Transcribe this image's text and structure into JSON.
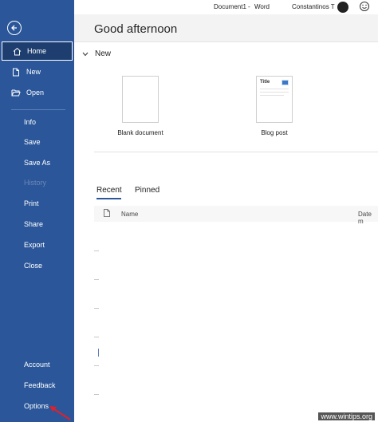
{
  "titlebar": {
    "document": "Document1",
    "separator": "-",
    "app": "Word",
    "user": "Constantinos T"
  },
  "sidebar": {
    "back_icon": "back-arrow-icon",
    "items": [
      {
        "label": "Home",
        "icon": "home-icon"
      },
      {
        "label": "New",
        "icon": "new-document-icon"
      },
      {
        "label": "Open",
        "icon": "folder-open-icon"
      },
      {
        "label": "Info"
      },
      {
        "label": "Save"
      },
      {
        "label": "Save As"
      },
      {
        "label": "History"
      },
      {
        "label": "Print"
      },
      {
        "label": "Share"
      },
      {
        "label": "Export"
      },
      {
        "label": "Close"
      },
      {
        "label": "Account"
      },
      {
        "label": "Feedback"
      },
      {
        "label": "Options"
      }
    ],
    "colors": {
      "background": "#2b579a",
      "selected": "#1e3e70"
    }
  },
  "main": {
    "greeting": "Good afternoon",
    "new_section": {
      "title": "New",
      "templates": [
        {
          "label": "Blank document"
        },
        {
          "label": "Blog post",
          "thumb_title": "Title"
        }
      ]
    },
    "tabs": [
      {
        "label": "Recent",
        "active": true
      },
      {
        "label": "Pinned",
        "active": false
      }
    ],
    "list_header": {
      "name": "Name",
      "date": "Date m"
    }
  },
  "watermark": "www.wintips.org"
}
